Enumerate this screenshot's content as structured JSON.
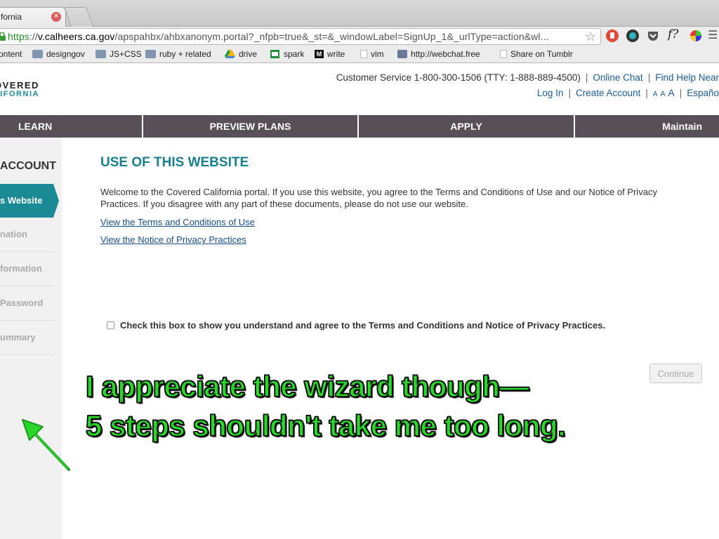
{
  "browser": {
    "tab_title": "fornia",
    "url_scheme": "https",
    "url_sep": "://",
    "url_host": "v.calheers.ca.gov",
    "url_path": "/apspahbx/ahbxanonym.portal?_nfpb=true&_st=&_windowLabel=SignUp_1&_urlType=action&wl..."
  },
  "bookmarks": [
    {
      "label": "ontent",
      "icon": "none"
    },
    {
      "label": "designgov",
      "icon": "folder-icon"
    },
    {
      "label": "JS+CSS",
      "icon": "folder-icon"
    },
    {
      "label": "ruby + related",
      "icon": "folder-icon"
    },
    {
      "label": "drive",
      "icon": "drive-icon"
    },
    {
      "label": "spark",
      "icon": "sheet-icon"
    },
    {
      "label": "write",
      "icon": "m-icon"
    },
    {
      "label": "vim",
      "icon": "page-icon"
    },
    {
      "label": "http://webchat.free",
      "icon": "globe-icon"
    },
    {
      "label": "Share on Tumblr",
      "icon": "page-icon"
    }
  ],
  "header": {
    "logo_line1": "OVERED",
    "logo_line2": "LIFORNIA",
    "customer_service": "Customer Service 1-800-300-1506 (TTY: 1-888-889-4500)",
    "online_chat": "Online Chat",
    "find_help": "Find Help Near",
    "login": "Log In",
    "create_account": "Create Account",
    "text_size": "A A A",
    "espanol": "Españo"
  },
  "nav": [
    "LEARN",
    "PREVIEW PLANS",
    "APPLY",
    "Maintain"
  ],
  "sidebar": {
    "heading": "ACCOUNT",
    "active": "s Website",
    "steps": [
      "nation",
      "formation",
      "Password",
      "ummary"
    ]
  },
  "main": {
    "title": "USE OF THIS WEBSITE",
    "intro": "Welcome to the Covered California portal. If you use this website, you agree to the Terms and Conditions of Use and our Notice of Privacy Practices. If you disagree with any part of these documents, please do not use our website.",
    "link_terms": "View the Terms and Conditions of Use",
    "link_privacy": "View the Notice of Privacy Practices",
    "agree_label": "Check this box to show you understand and agree to the Terms and Conditions and Notice of Privacy Practices.",
    "continue_label": "Continue"
  },
  "annotation": {
    "line1": "I appreciate the wizard though—",
    "line2": "5 steps shouldn't take me too long.",
    "color": "#2ad62a"
  }
}
